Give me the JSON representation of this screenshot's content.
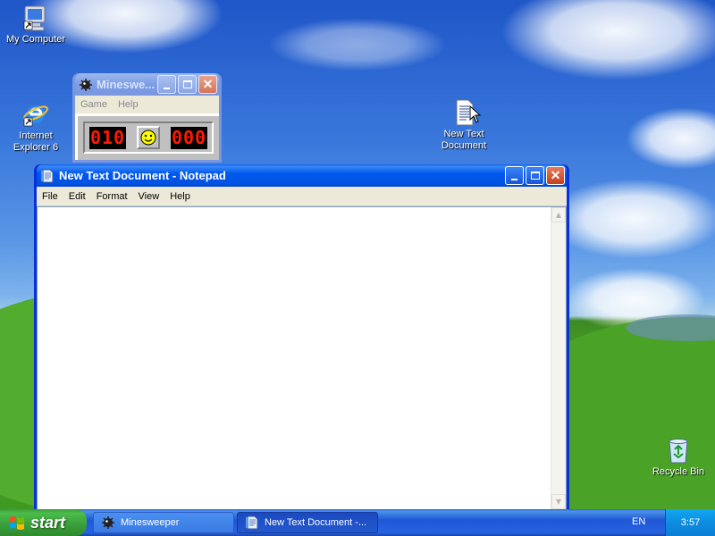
{
  "desktop": {
    "icons": [
      {
        "label": "My Computer"
      },
      {
        "label": "Internet\nExplorer 6"
      },
      {
        "label": "New Text\nDocument"
      },
      {
        "label": "Recycle Bin"
      }
    ]
  },
  "minesweeper": {
    "title": "Mineswe...",
    "menu": [
      "Game",
      "Help"
    ],
    "mine_counter": "010",
    "timer": "000"
  },
  "notepad": {
    "title": "New Text Document - Notepad",
    "menu": [
      "File",
      "Edit",
      "Format",
      "View",
      "Help"
    ],
    "content": ""
  },
  "taskbar": {
    "start_label": "start",
    "tasks": [
      {
        "label": "Minesweeper"
      },
      {
        "label": "New Text Document -..."
      }
    ],
    "language": "EN",
    "clock": "3:57"
  },
  "colors": {
    "xp_blue": "#0831d9",
    "start_green": "#3a9d3a",
    "led_red": "#ff1a00"
  }
}
